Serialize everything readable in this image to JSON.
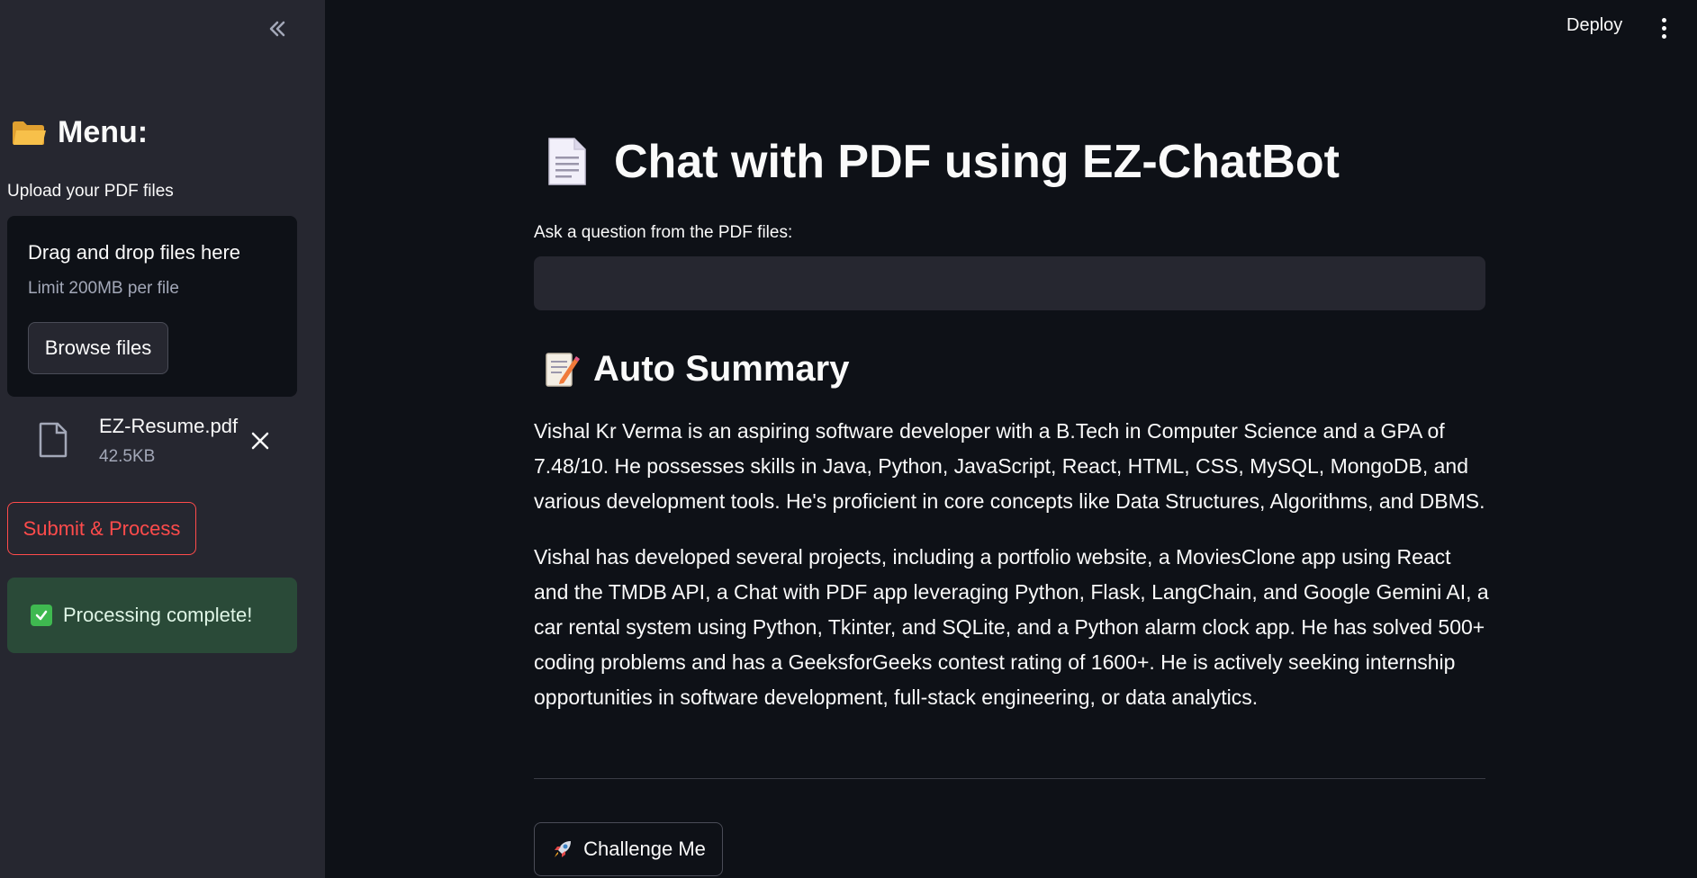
{
  "header": {
    "deploy_label": "Deploy"
  },
  "sidebar": {
    "title": "Menu:",
    "upload_label": "Upload your PDF files",
    "dropzone": {
      "title": "Drag and drop files here",
      "limit": "Limit 200MB per file",
      "browse_label": "Browse files"
    },
    "file": {
      "name": "EZ-Resume.pdf",
      "size": "42.5KB"
    },
    "submit_label": "Submit & Process",
    "success_message": "Processing complete!"
  },
  "main": {
    "title": "Chat with PDF using EZ-ChatBot",
    "question_label": "Ask a question from the PDF files:",
    "question_value": "",
    "summary_heading": "Auto Summary",
    "summary_paragraphs": [
      "Vishal Kr Verma is an aspiring software developer with a B.Tech in Computer Science and a GPA of 7.48/10. He possesses skills in Java, Python, JavaScript, React, HTML, CSS, MySQL, MongoDB, and various development tools. He's proficient in core concepts like Data Structures, Algorithms, and DBMS.",
      "Vishal has developed several projects, including a portfolio website, a MoviesClone app using React and the TMDB API, a Chat with PDF app leveraging Python, Flask, LangChain, and Google Gemini AI, a car rental system using Python, Tkinter, and SQLite, and a Python alarm clock app. He has solved 500+ coding problems and has a GeeksforGeeks contest rating of 1600+. He is actively seeking internship opportunities in software development, full-stack engineering, or data analytics."
    ],
    "challenge_label": "Challenge Me"
  },
  "icons": {
    "collapse": "double-chevron-left-icon",
    "menu_folder": "folder-icon",
    "file": "file-icon",
    "remove": "close-icon",
    "success": "check-icon",
    "title": "document-icon",
    "summary": "memo-icon",
    "challenge": "rocket-icon",
    "more": "kebab-menu-icon"
  },
  "colors": {
    "background": "#0e1117",
    "sidebar": "#262730",
    "accent": "#ff4b4b",
    "success_bg": "#2a4a38"
  }
}
